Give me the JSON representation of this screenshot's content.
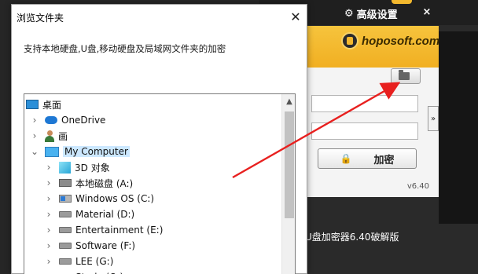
{
  "app": {
    "settings_label": "高级设置",
    "close_label": "×",
    "logo_text": "hoposoft.com",
    "encrypt_label": "加密",
    "version": "v6.40",
    "expand_label": "»",
    "caption": "U盘加密器6.40破解版",
    "brand_color": "#f1af22"
  },
  "dialog": {
    "title": "浏览文件夹",
    "close_label": "✕",
    "description": "支持本地硬盘,U盘,移动硬盘及局域网文件夹的加密",
    "tree": [
      {
        "label": "桌面",
        "icon": "desktop-icon",
        "expanded": null
      },
      {
        "label": "OneDrive",
        "icon": "onedrive-cloud-icon",
        "expanded": false
      },
      {
        "label": "画",
        "icon": "user-icon",
        "expanded": false
      },
      {
        "label": "My Computer",
        "icon": "computer-icon",
        "expanded": true,
        "selected": true
      },
      {
        "label": "3D 对象",
        "icon": "3d-objects-icon",
        "expanded": false
      },
      {
        "label": "本地磁盘 (A:)",
        "icon": "drive-icon",
        "expanded": false
      },
      {
        "label": "Windows OS (C:)",
        "icon": "system-drive-icon",
        "expanded": false
      },
      {
        "label": "Material (D:)",
        "icon": "drive-icon",
        "expanded": false
      },
      {
        "label": "Entertainment (E:)",
        "icon": "drive-icon",
        "expanded": false
      },
      {
        "label": "Software (F:)",
        "icon": "drive-icon",
        "expanded": false
      },
      {
        "label": "LEE (G:)",
        "icon": "drive-icon",
        "expanded": false
      },
      {
        "label": "Study (O:)",
        "icon": "drive-icon",
        "expanded": false
      }
    ]
  },
  "annotation": {
    "arrow_color": "#e8201f"
  }
}
